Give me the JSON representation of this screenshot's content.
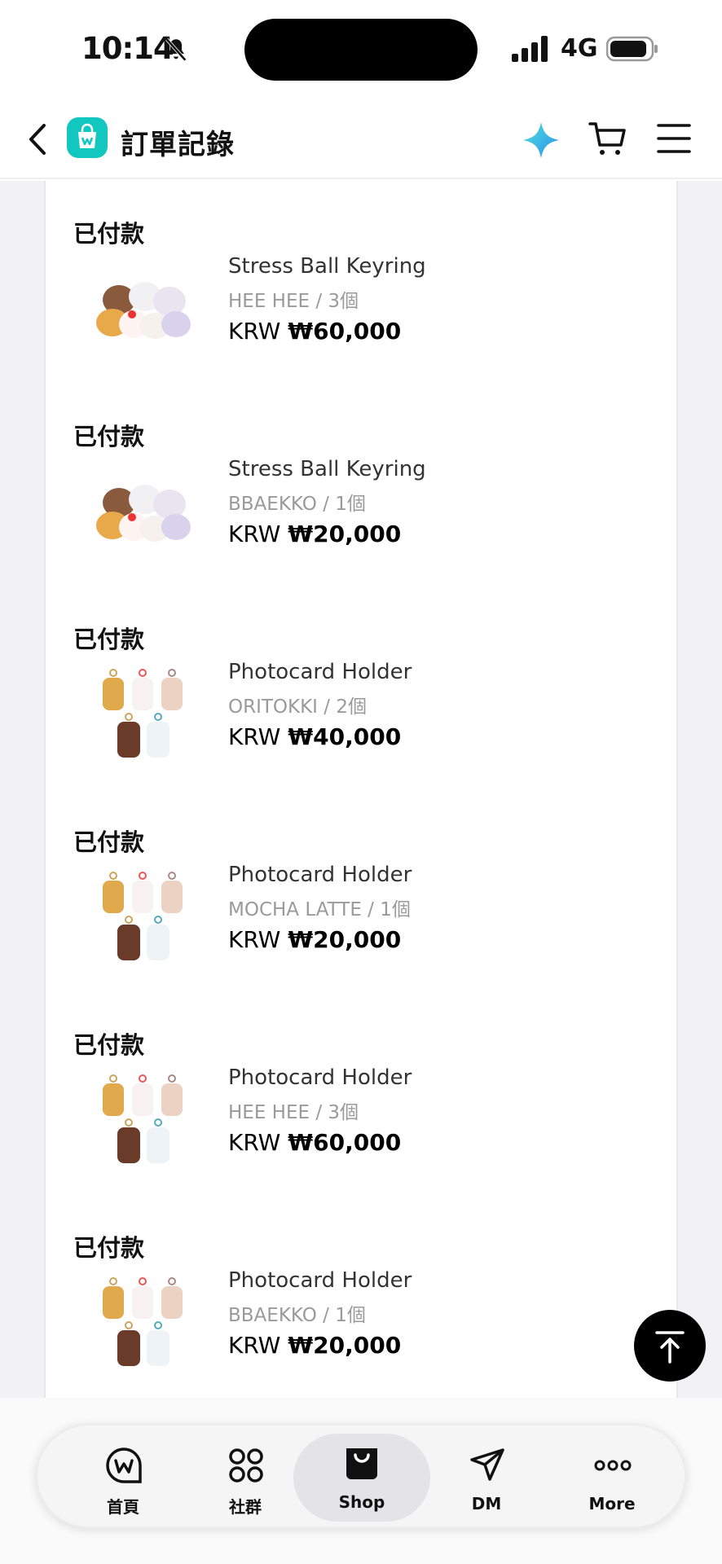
{
  "status_bar": {
    "time": "10:14",
    "network": "4G",
    "icons": [
      "bell-off-icon",
      "signal-icon",
      "battery-icon"
    ]
  },
  "header": {
    "title": "訂單記錄",
    "icons": [
      "back-icon",
      "shop-logo",
      "sparkle-icon",
      "cart-icon",
      "menu-icon"
    ]
  },
  "orders": [
    {
      "status": "已付款",
      "name": "Stress Ball Keyring",
      "variant": "HEE HEE / 3個",
      "currency": "KRW",
      "amount": "₩60,000",
      "thumb": "keyring-plush"
    },
    {
      "status": "已付款",
      "name": "Stress Ball Keyring",
      "variant": "BBAEKKO / 1個",
      "currency": "KRW",
      "amount": "₩20,000",
      "thumb": "keyring-plush"
    },
    {
      "status": "已付款",
      "name": "Photocard Holder",
      "variant": "ORITOKKI / 2個",
      "currency": "KRW",
      "amount": "₩40,000",
      "thumb": "photocard-holder"
    },
    {
      "status": "已付款",
      "name": "Photocard Holder",
      "variant": "MOCHA LATTE / 1個",
      "currency": "KRW",
      "amount": "₩20,000",
      "thumb": "photocard-holder"
    },
    {
      "status": "已付款",
      "name": "Photocard Holder",
      "variant": "HEE HEE / 3個",
      "currency": "KRW",
      "amount": "₩60,000",
      "thumb": "photocard-holder"
    },
    {
      "status": "已付款",
      "name": "Photocard Holder",
      "variant": "BBAEKKO / 1個",
      "currency": "KRW",
      "amount": "₩20,000",
      "thumb": "photocard-holder"
    }
  ],
  "tabs": [
    {
      "label": "首頁",
      "icon": "weverse-home-icon"
    },
    {
      "label": "社群",
      "icon": "community-grid-icon"
    },
    {
      "label": "Shop",
      "icon": "shop-bag-icon",
      "active": true
    },
    {
      "label": "DM",
      "icon": "dm-send-icon"
    },
    {
      "label": "More",
      "icon": "more-dots-icon"
    }
  ],
  "colors": {
    "accent": "#12c7c0",
    "text": "#111111",
    "muted": "#9a9a9a"
  }
}
